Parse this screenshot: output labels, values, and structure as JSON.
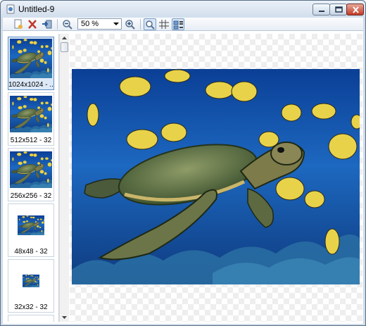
{
  "window": {
    "title": "Untitled-9"
  },
  "toolbar": {
    "zoom_value": "50 %",
    "buttons": [
      "new-page-icon",
      "delete-icon",
      "export-icon",
      "zoom-out-icon",
      "zoom-in-icon",
      "zoom-tool-icon",
      "grid-icon",
      "thumbnail-view-icon"
    ]
  },
  "thumbnails": [
    {
      "label": "1024x1024 - ...",
      "selected": true
    },
    {
      "label": "512x512 - 32",
      "selected": false
    },
    {
      "label": "256x256 - 32",
      "selected": false
    },
    {
      "label": "48x48 - 32",
      "selected": false
    },
    {
      "label": "32x32 - 32",
      "selected": false
    }
  ],
  "colors": {
    "selection": "#dde9f7",
    "water": "#1d5fb0",
    "titlebar": "#d2deec"
  }
}
